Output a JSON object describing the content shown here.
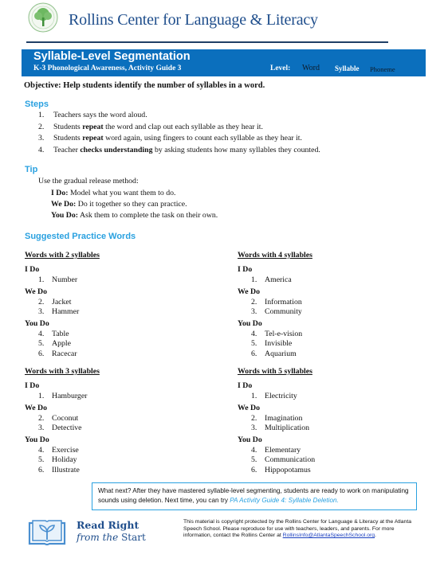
{
  "header": {
    "org_title": "Rollins Center for Language & Literacy",
    "logo_icon": "tree-seal-icon"
  },
  "banner": {
    "title": "Syllable-Level Segmentation",
    "subtitle": "K-3 Phonological Awareness, Activity Guide 3",
    "level_label": "Level:",
    "levels": [
      "Word",
      "Syllable",
      "Phoneme"
    ],
    "active_level": "Syllable",
    "color": "#0b6fbd"
  },
  "objective": "Objective: Help students identify the number of syllables in a word.",
  "steps": {
    "heading": "Steps",
    "items": [
      {
        "num": "1.",
        "pre": "Teachers says the word aloud.",
        "bold": "",
        "post": ""
      },
      {
        "num": "2.",
        "pre": "Students ",
        "bold": "repeat",
        "post": " the word and clap out each syllable as they hear it."
      },
      {
        "num": "3.",
        "pre": "Students ",
        "bold": "repeat",
        "post": " word again, using fingers to count each syllable as they hear it."
      },
      {
        "num": "4.",
        "pre": "Teacher ",
        "bold": "checks understanding",
        "post": " by asking students how many syllables they counted."
      }
    ]
  },
  "tip": {
    "heading": "Tip",
    "intro": "Use the gradual release method:",
    "lines": [
      {
        "label": "I Do:",
        "text": " Model what you want them to do."
      },
      {
        "label": "We Do:",
        "text": " Do it together so they can practice."
      },
      {
        "label": "You Do:",
        "text": " Ask them to complete the task on their own."
      }
    ]
  },
  "practice": {
    "heading": "Suggested Practice Words",
    "phase_labels": {
      "i_do": "I Do",
      "we_do": "We Do",
      "you_do": "You Do"
    },
    "lists": [
      {
        "title": "Words with 2 syllables",
        "i_do": [
          "Number"
        ],
        "we_do": [
          "Jacket",
          "Hammer"
        ],
        "you_do": [
          "Table",
          "Apple",
          "Racecar"
        ]
      },
      {
        "title": "Words with 4 syllables",
        "i_do": [
          "America"
        ],
        "we_do": [
          "Information",
          "Community"
        ],
        "you_do": [
          "Tel-e-vision",
          "Invisible",
          "Aquarium"
        ]
      },
      {
        "title": "Words with 3 syllables",
        "i_do": [
          "Hamburger"
        ],
        "we_do": [
          "Coconut",
          "Detective"
        ],
        "you_do": [
          "Exercise",
          "Holiday",
          "Illustrate"
        ]
      },
      {
        "title": "Words with 5 syllables",
        "i_do": [
          "Electricity"
        ],
        "we_do": [
          "Imagination",
          "Multiplication"
        ],
        "you_do": [
          "Elementary",
          "Communication",
          "Hippopotamus"
        ]
      }
    ]
  },
  "what_next": {
    "text": "What next? After they have mastered syllable-level segmenting, students are ready to work on manipulating sounds using deletion. Next time, you can try ",
    "link": "PA Activity Guide 4: Syllable Deletion."
  },
  "footer": {
    "brand_line1": "Read Right",
    "brand_line2_italic": "from the",
    "brand_line2_rest": " Start",
    "copyright": "This material is copyright protected by the Rollins Center for Language & Literacy at the Atlanta Speech School. Please reproduce for use with teachers, leaders, and parents. For more information, contact the Rollins Center at ",
    "email": "RollinsInfo@AtlantaSpeechSchool.org",
    "email_suffix": "."
  }
}
